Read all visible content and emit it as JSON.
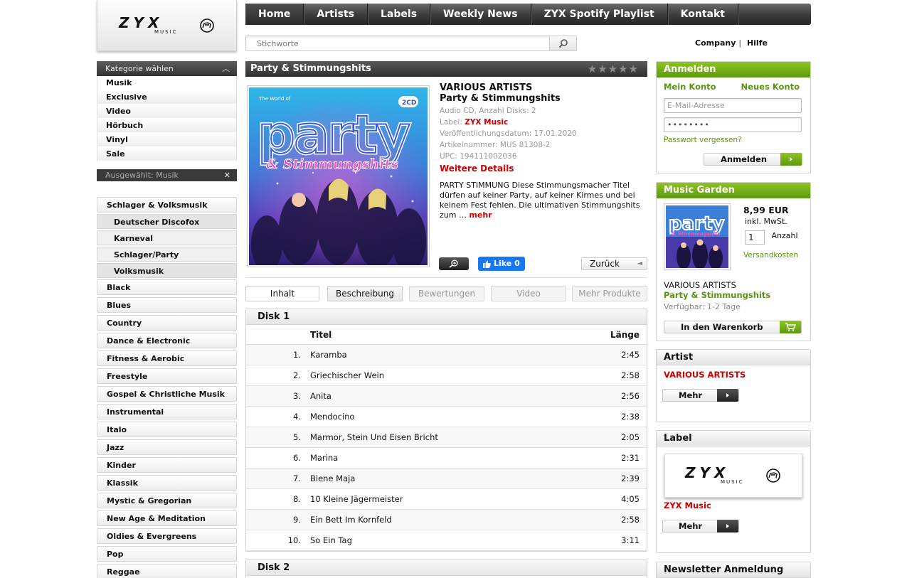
{
  "logo": {
    "name": "ZYX",
    "sub": "MUSIC"
  },
  "nav": [
    "Home",
    "Artists",
    "Labels",
    "Weekly News",
    "ZYX Spotify Playlist",
    "Kontakt"
  ],
  "search": {
    "placeholder": "Stichworte"
  },
  "toplinks": {
    "company": "Company",
    "sep": "|",
    "help": "Hilfe"
  },
  "category": {
    "header": "Kategorie wählen",
    "items": [
      "Musik",
      "Exclusive",
      "Video",
      "Hörbuch",
      "Vinyl",
      "Sale"
    ],
    "selected": "Ausgewählt: Musik"
  },
  "genres": {
    "open": "Schlager & Volksmusik",
    "sub": [
      "Deutscher Discofox",
      "Karneval",
      "Schlager/Party",
      "Volksmusik"
    ],
    "list": [
      "Black",
      "Blues",
      "Country",
      "Dance & Electronic",
      "Fitness & Aerobic",
      "Freestyle",
      "Gospel & Christliche Musik",
      "Instrumental",
      "Italo",
      "Jazz",
      "Kinder",
      "Klassik",
      "Mystic & Gregorian",
      "New Age & Meditation",
      "Oldies & Evergreens",
      "Pop",
      "Reggae"
    ]
  },
  "product": {
    "heading": "Party & Stimmungshits",
    "rating": 0,
    "artist": "VARIOUS ARTISTS",
    "title": "Party & Stimmungshits",
    "format": "Audio CD, Anzahl Disks: 2",
    "label_prefix": "Label:",
    "label": "ZYX Music",
    "release": "Veröffentlichungsdatum: 17.01.2020",
    "article": "Artikelnummer: MUS 81308-2",
    "upc": "UPC: 194111002036",
    "details_link": "Weitere Details",
    "description": "PARTY STIMMUNG Diese Stimmungsmacher Titel dürfen auf keiner Party, auf keiner Kirmes und bei keinem Fest fehlen. Die ultimativen Stimmungshits zum …",
    "more": "mehr",
    "cover_text": {
      "top": "The World of",
      "word": "party",
      "sub": "& Stimmungshits",
      "badge": "2CD"
    }
  },
  "actions": {
    "fb_like": "Like 0",
    "back": "Zurück"
  },
  "tabs": [
    "Inhalt",
    "Beschreibung",
    "Bewertungen",
    "Video",
    "Mehr Produkte"
  ],
  "tracklist": {
    "col_title": "Titel",
    "col_length": "Länge",
    "disks": [
      {
        "name": "Disk 1",
        "tracks": [
          {
            "no": "1.",
            "title": "Karamba",
            "len": "2:45"
          },
          {
            "no": "2.",
            "title": "Griechischer Wein",
            "len": "2:58"
          },
          {
            "no": "3.",
            "title": "Anita",
            "len": "2:56"
          },
          {
            "no": "4.",
            "title": "Mendocino",
            "len": "2:38"
          },
          {
            "no": "5.",
            "title": "Marmor, Stein Und Eisen Bricht",
            "len": "2:05"
          },
          {
            "no": "6.",
            "title": "Marina",
            "len": "2:31"
          },
          {
            "no": "7.",
            "title": "Biene Maja",
            "len": "2:39"
          },
          {
            "no": "8.",
            "title": "10 Kleine Jägermeister",
            "len": "4:05"
          },
          {
            "no": "9.",
            "title": "Ein Bett Im Kornfeld",
            "len": "2:58"
          },
          {
            "no": "10.",
            "title": "So Ein Tag",
            "len": "3:11"
          }
        ]
      },
      {
        "name": "Disk 2",
        "tracks": []
      }
    ]
  },
  "login": {
    "header": "Anmelden",
    "my_account": "Mein Konto",
    "new_account": "Neues Konto",
    "email_placeholder": "E-Mail-Adresse",
    "password_mask": "••••••••",
    "forgot": "Passwort vergessen?",
    "button": "Anmelden"
  },
  "music_garden": {
    "header": "Music Garden",
    "price": "8,99 EUR",
    "vat": "inkl. MwSt.",
    "qty": "1",
    "qty_label": "Anzahl",
    "shipping": "Versandkosten",
    "artist": "VARIOUS ARTISTS",
    "title": "Party & Stimmungshits",
    "availability": "Verfügbar:  1-2 Tage",
    "cart_button": "In den Warenkorb"
  },
  "artist_box": {
    "header": "Artist",
    "name": "VARIOUS ARTISTS",
    "button": "Mehr"
  },
  "label_box": {
    "header": "Label",
    "name": "ZYX Music",
    "button": "Mehr"
  },
  "newsletter": {
    "header": "Newsletter Anmeldung"
  },
  "colors": {
    "accent_green": "#6aa815",
    "link_red": "#cc0000",
    "nav_dark": "#333333"
  },
  "icons": [
    "search-icon",
    "chevron-up-icon",
    "close-icon",
    "star-icon",
    "zoom-icon",
    "facebook-thumb-icon",
    "arrow-left-icon",
    "arrow-right-icon",
    "cart-icon"
  ]
}
